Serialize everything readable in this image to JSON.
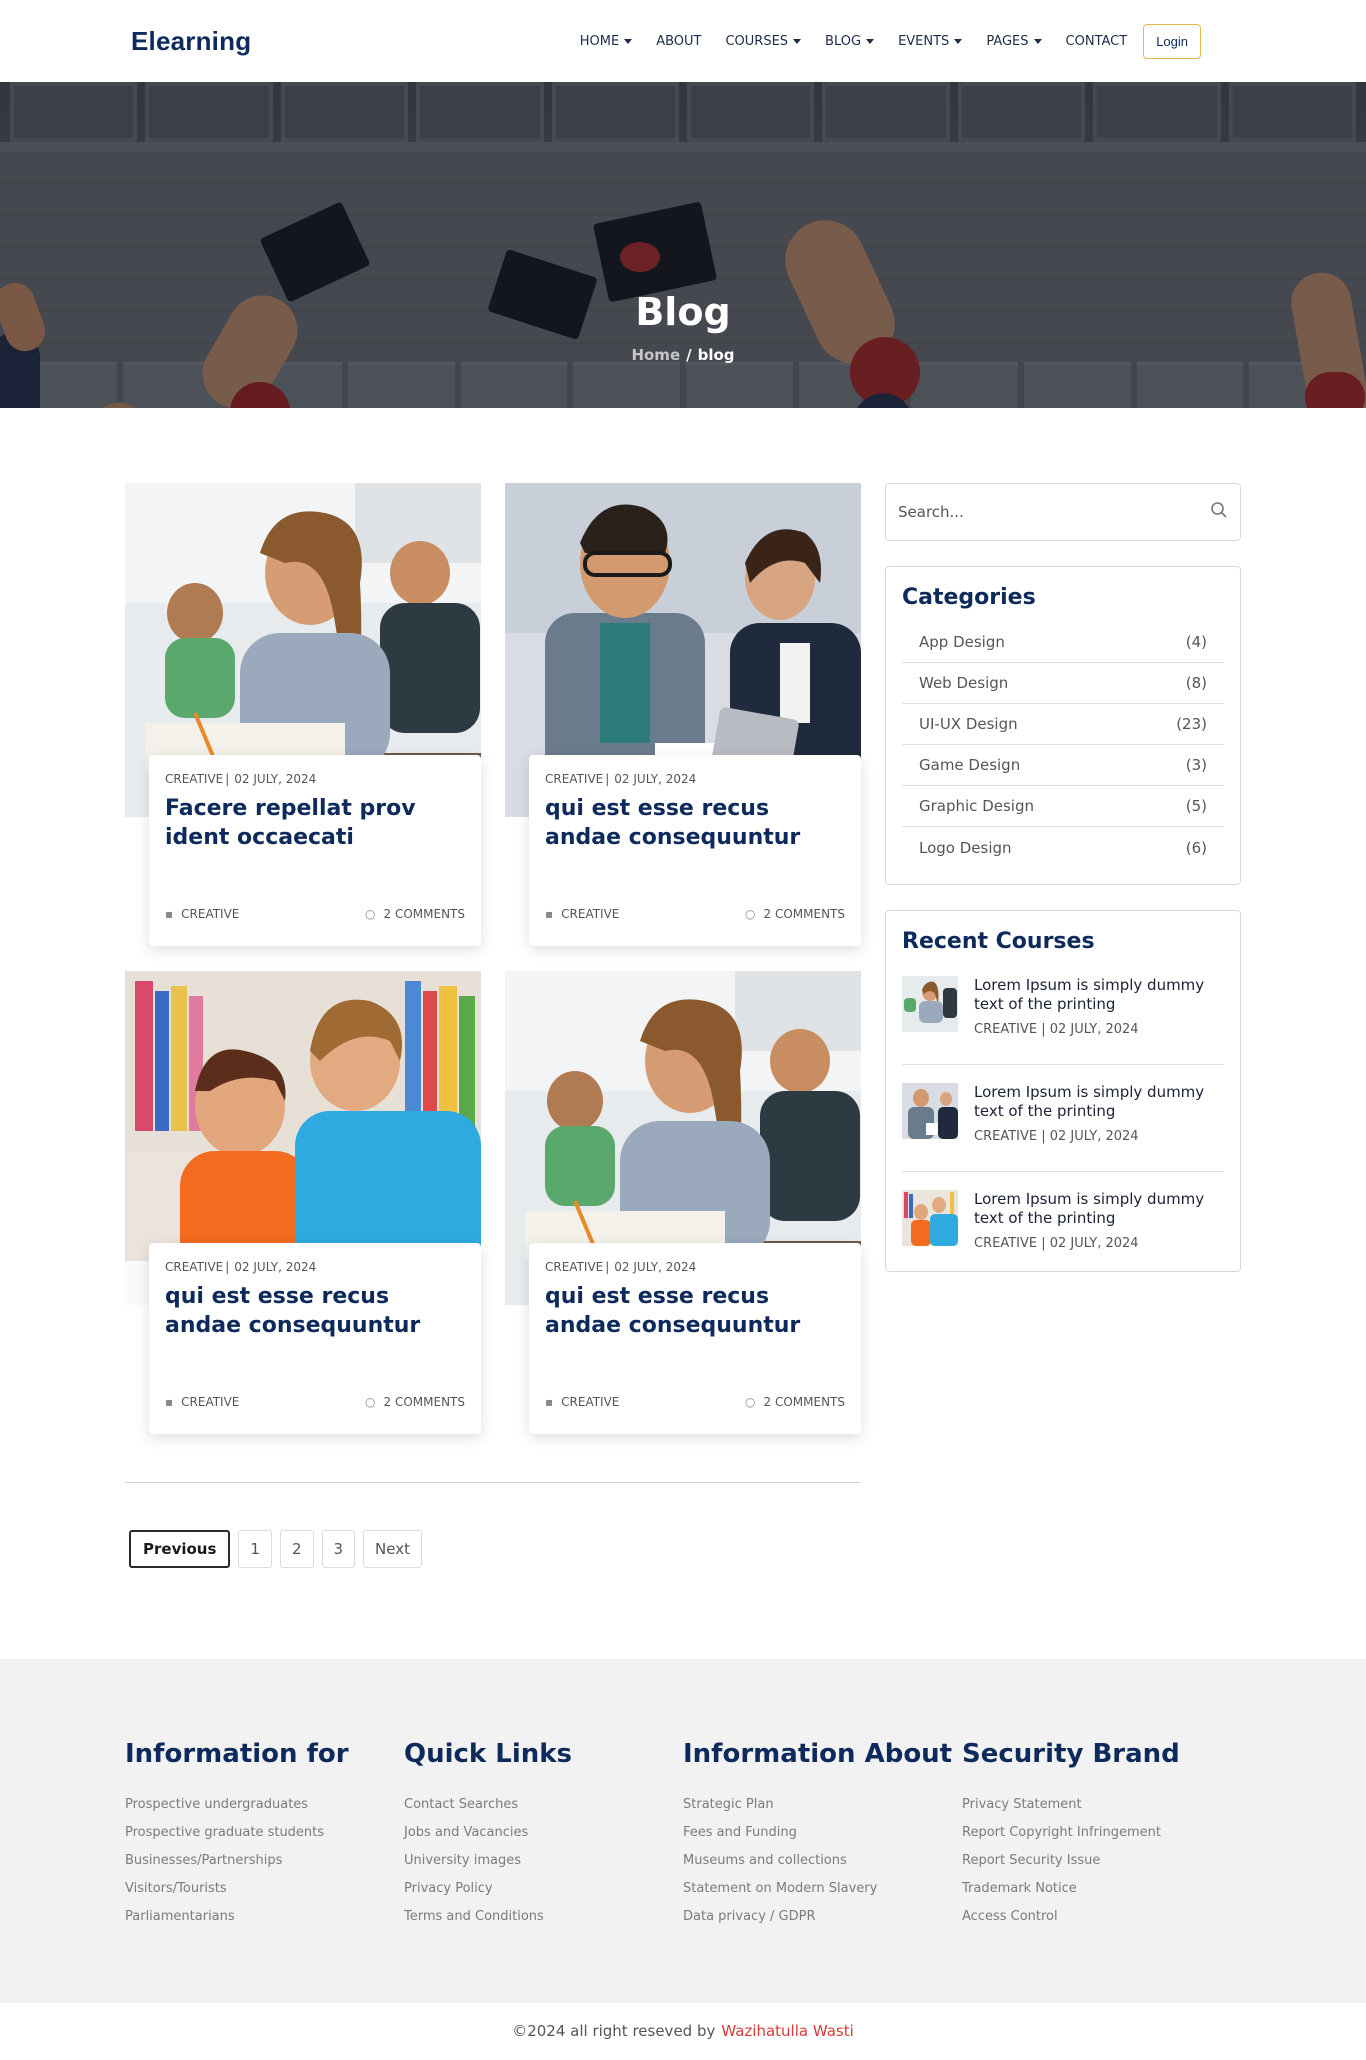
{
  "nav": {
    "brand": "Elearning",
    "items": [
      {
        "label": "HOME",
        "dropdown": true
      },
      {
        "label": "ABOUT",
        "dropdown": false
      },
      {
        "label": "COURSES",
        "dropdown": true
      },
      {
        "label": "BLOG",
        "dropdown": true
      },
      {
        "label": "EVENTS",
        "dropdown": true
      },
      {
        "label": "PAGES",
        "dropdown": true
      },
      {
        "label": "CONTACT",
        "dropdown": false
      }
    ],
    "login_label": "Login"
  },
  "hero": {
    "title": "Blog",
    "breadcrumb_home": "Home",
    "breadcrumb_sep": "/",
    "breadcrumb_current": "blog"
  },
  "posts": [
    {
      "category": "CREATIVE",
      "date": "02 JULY, 2024",
      "title": "Facere repellat prov ident occaecati",
      "tag": "CREATIVE",
      "comments": "2 COMMENTS",
      "image": "student-writing-classroom"
    },
    {
      "category": "CREATIVE",
      "date": "02 JULY, 2024",
      "title": "qui est esse recus andae consequuntur",
      "tag": "CREATIVE",
      "comments": "2 COMMENTS",
      "image": "man-woman-tablet"
    },
    {
      "category": "CREATIVE",
      "date": "02 JULY, 2024",
      "title": "qui est esse recus andae consequuntur",
      "tag": "CREATIVE",
      "comments": "2 COMMENTS",
      "image": "kids-studying-library"
    },
    {
      "category": "CREATIVE",
      "date": "02 JULY, 2024",
      "title": "qui est esse recus andae consequuntur",
      "tag": "CREATIVE",
      "comments": "2 COMMENTS",
      "image": "student-writing-classroom"
    }
  ],
  "pagination": {
    "previous": "Previous",
    "pages": [
      "1",
      "2",
      "3"
    ],
    "next": "Next"
  },
  "sidebar": {
    "search_placeholder": "Search...",
    "categories_title": "Categories",
    "categories": [
      {
        "name": "App Design",
        "count": "(4)"
      },
      {
        "name": "Web Design",
        "count": "(8)"
      },
      {
        "name": "UI-UX Design",
        "count": "(23)"
      },
      {
        "name": "Game Design",
        "count": "(3)"
      },
      {
        "name": "Graphic Design",
        "count": "(5)"
      },
      {
        "name": "Logo Design",
        "count": "(6)"
      }
    ],
    "recent_title": "Recent Courses",
    "recent": [
      {
        "title": "Lorem Ipsum is simply dummy text of the printing",
        "category": "CREATIVE",
        "date": "02 JULY, 2024",
        "image": "student-writing-classroom"
      },
      {
        "title": "Lorem Ipsum is simply dummy text of the printing",
        "category": "CREATIVE",
        "date": "02 JULY, 2024",
        "image": "man-woman-tablet"
      },
      {
        "title": "Lorem Ipsum is simply dummy text of the printing",
        "category": "CREATIVE",
        "date": "02 JULY, 2024",
        "image": "kids-studying-library"
      }
    ]
  },
  "footer": {
    "columns": [
      {
        "title": "Information for",
        "links": [
          "Prospective undergraduates",
          "Prospective graduate students",
          "Businesses/Partnerships",
          "Visitors/Tourists",
          "Parliamentarians"
        ]
      },
      {
        "title": "Quick Links",
        "links": [
          "Contact Searches",
          "Jobs and Vacancies",
          "University images",
          "Privacy Policy",
          "Terms and Conditions"
        ]
      },
      {
        "title": "Information About",
        "links": [
          "Strategic Plan",
          "Fees and Funding",
          "Museums and collections",
          "Statement on Modern Slavery",
          "Data privacy / GDPR"
        ]
      },
      {
        "title": "Security Brand",
        "links": [
          "Privacy Statement",
          "Report Copyright Infringement",
          "Report Security Issue",
          "Trademark Notice",
          "Access Control"
        ]
      }
    ],
    "copyright": "©2024 all right reseved by",
    "author": "Wazihatulla Wasti"
  },
  "colors": {
    "brand_navy": "#0e2a5c",
    "login_border": "#e6b84a",
    "author_red": "#d63b3b",
    "footer_bg": "#f2f2f2"
  }
}
